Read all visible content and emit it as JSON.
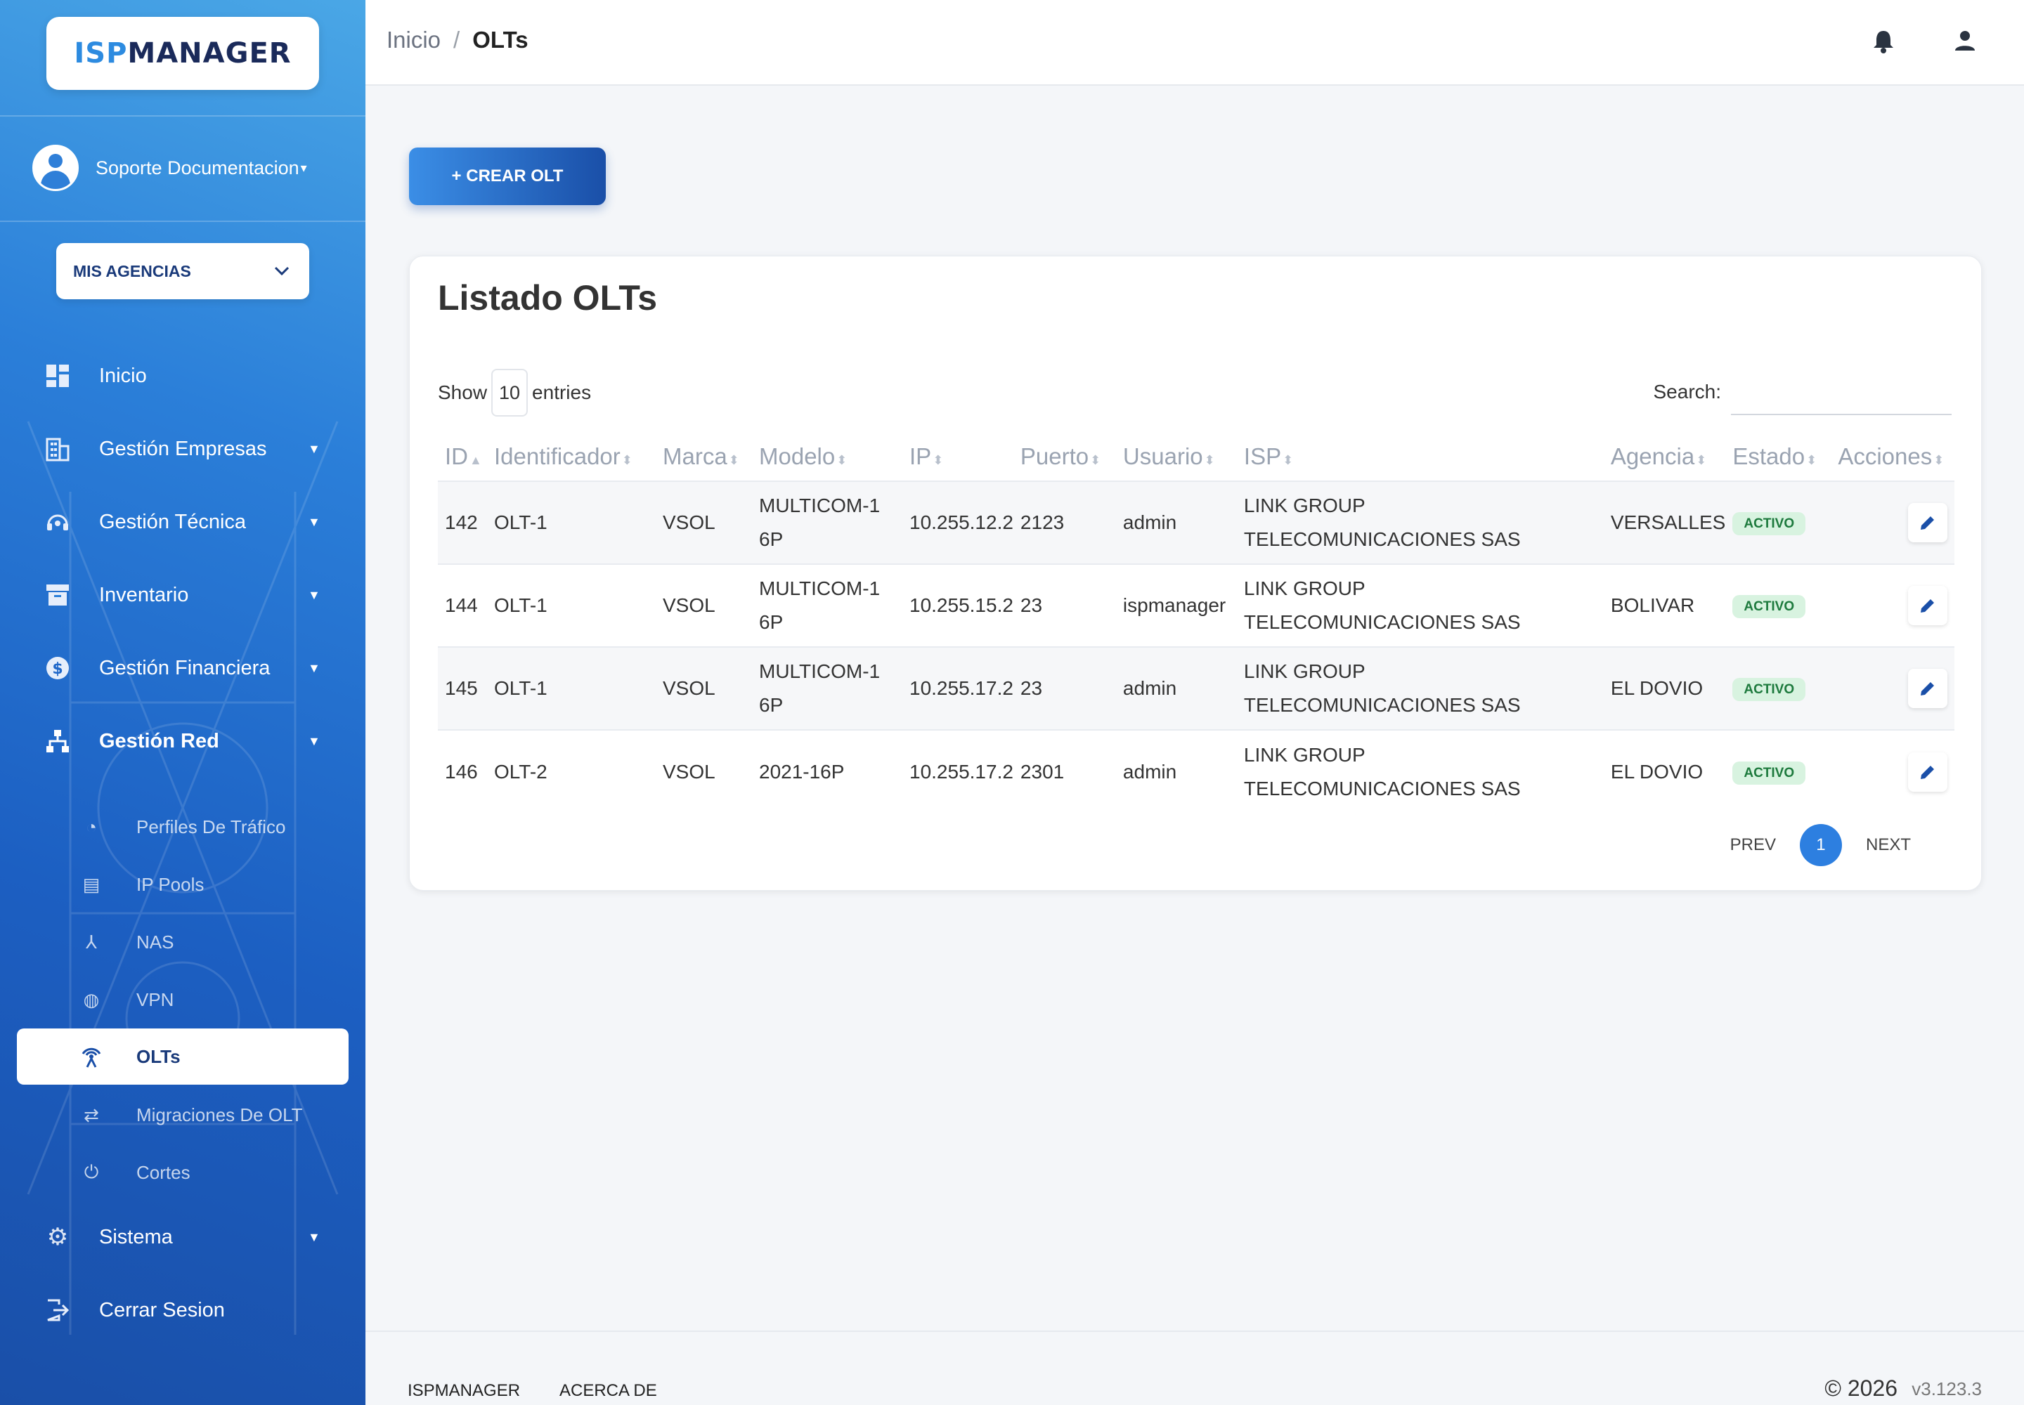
{
  "brand": {
    "part1": "ISP",
    "part2": "MANAGER",
    "accent": "#2d8be0",
    "dark": "#1a2a5a"
  },
  "user": {
    "name": "Soporte Documentacion"
  },
  "agency_selector": {
    "label": "MIS AGENCIAS"
  },
  "nav": [
    {
      "label": "Inicio",
      "icon": "dashboard-icon"
    },
    {
      "label": "Gestión Empresas",
      "icon": "building-icon"
    },
    {
      "label": "Gestión Técnica",
      "icon": "support-agent-icon"
    },
    {
      "label": "Inventario",
      "icon": "archive-icon"
    },
    {
      "label": "Gestión Financiera",
      "icon": "dollar-icon"
    },
    {
      "label": "Gestión Red",
      "icon": "network-icon"
    }
  ],
  "subnav": [
    {
      "label": "Perfiles De Tráfico",
      "icon": "speed-icon"
    },
    {
      "label": "IP Pools",
      "icon": "storage-icon"
    },
    {
      "label": "NAS",
      "icon": "hub-icon"
    },
    {
      "label": "VPN",
      "icon": "vpn-globe-icon"
    },
    {
      "label": "OLTs",
      "icon": "antenna-icon"
    },
    {
      "label": "Migraciones De OLT",
      "icon": "swap-icon"
    },
    {
      "label": "Cortes",
      "icon": "power-off-icon"
    }
  ],
  "nav_bottom": [
    {
      "label": "Sistema",
      "icon": "gear-icon"
    },
    {
      "label": "Cerrar Sesion",
      "icon": "logout-icon"
    }
  ],
  "breadcrumb": {
    "home": "Inicio",
    "separator": "/",
    "current": "OLTs"
  },
  "create_button": {
    "label": "+ CREAR OLT"
  },
  "card": {
    "title": "Listado OLTs"
  },
  "length": {
    "show": "Show",
    "value": "10",
    "entries": "entries"
  },
  "search": {
    "label": "Search:",
    "value": ""
  },
  "table": {
    "headers": [
      "ID",
      "Identificador",
      "Marca",
      "Modelo",
      "IP",
      "Puerto",
      "Usuario",
      "ISP",
      "Agencia",
      "Estado",
      "Acciones"
    ],
    "rows": [
      {
        "id": "142",
        "identificador": "OLT-1",
        "marca": "VSOL",
        "modelo": "MULTICOM-16P",
        "ip": "10.255.12.2",
        "puerto": "2123",
        "usuario": "admin",
        "isp": "LINK GROUP TELECOMUNICACIONES SAS",
        "agencia": "VERSALLES",
        "estado": "ACTIVO"
      },
      {
        "id": "144",
        "identificador": "OLT-1",
        "marca": "VSOL",
        "modelo": "MULTICOM-16P",
        "ip": "10.255.15.2",
        "puerto": "23",
        "usuario": "ispmanager",
        "isp": "LINK GROUP TELECOMUNICACIONES SAS",
        "agencia": "BOLIVAR",
        "estado": "ACTIVO"
      },
      {
        "id": "145",
        "identificador": "OLT-1",
        "marca": "VSOL",
        "modelo": "MULTICOM-16P",
        "ip": "10.255.17.2",
        "puerto": "23",
        "usuario": "admin",
        "isp": "LINK GROUP TELECOMUNICACIONES SAS",
        "agencia": "EL DOVIO",
        "estado": "ACTIVO"
      },
      {
        "id": "146",
        "identificador": "OLT-2",
        "marca": "VSOL",
        "modelo": "2021-16P",
        "ip": "10.255.17.2",
        "puerto": "2301",
        "usuario": "admin",
        "isp": "LINK GROUP TELECOMUNICACIONES SAS",
        "agencia": "EL DOVIO",
        "estado": "ACTIVO"
      }
    ]
  },
  "pagination": {
    "prev": "PREV",
    "current": "1",
    "next": "NEXT"
  },
  "footer": {
    "link1": "ISPMANAGER",
    "link2": "ACERCA DE",
    "copyright": "© 2026",
    "version": "v3.123.3"
  }
}
